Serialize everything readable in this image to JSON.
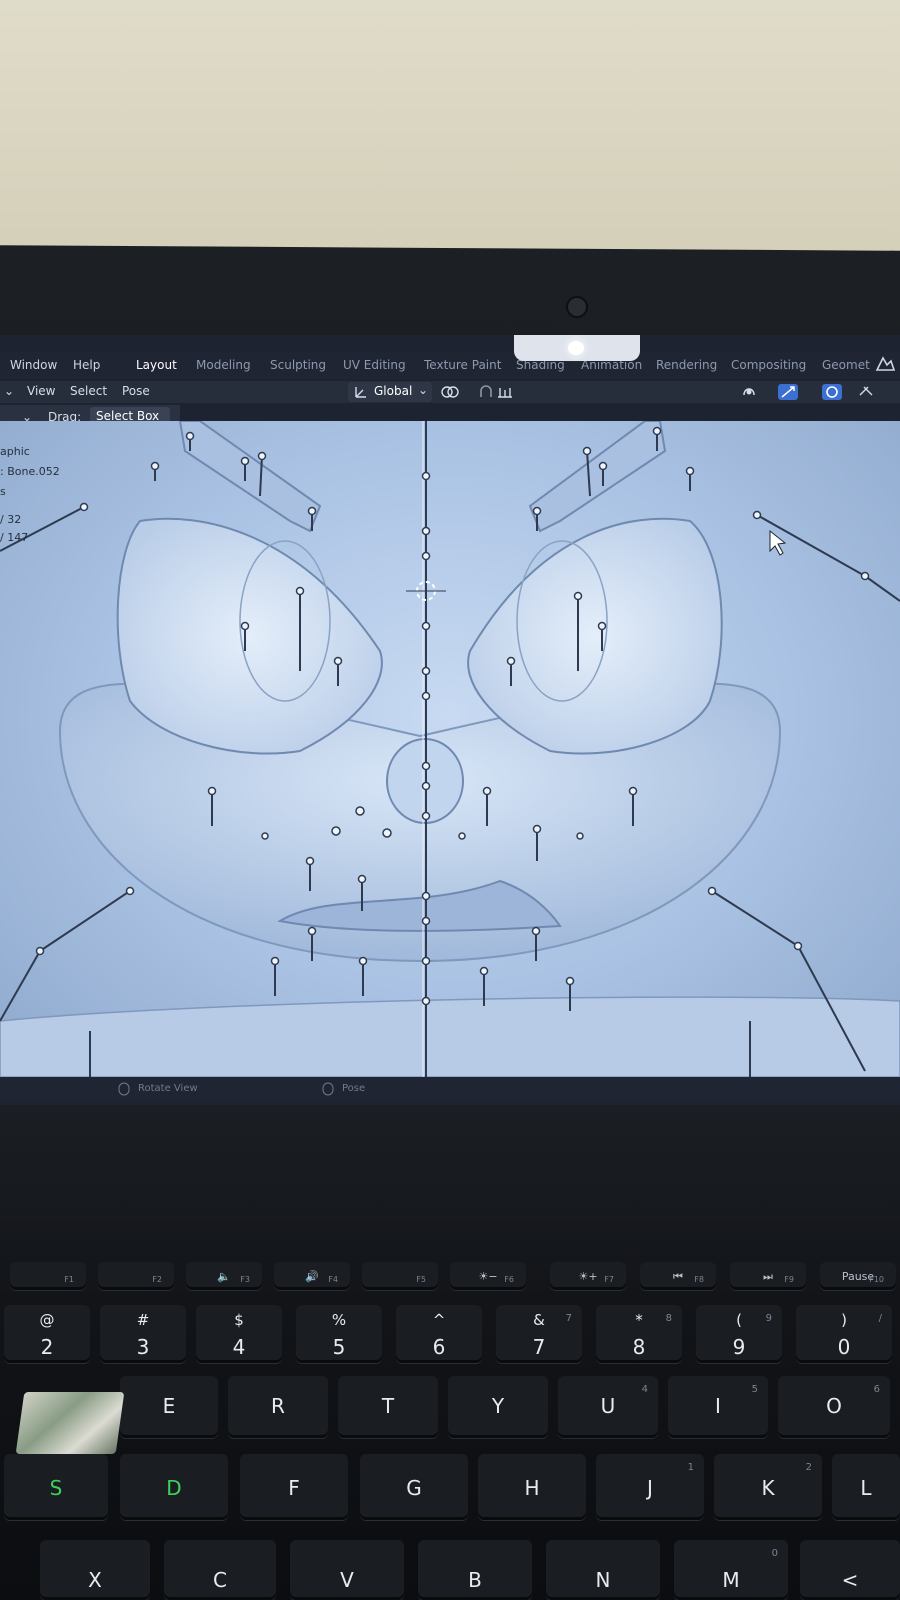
{
  "menu": {
    "items": [
      "Window",
      "Help"
    ],
    "workspace_tabs": [
      "Layout",
      "Modeling",
      "Sculpting",
      "UV Editing",
      "Texture Paint",
      "Shading",
      "Animation",
      "Rendering",
      "Compositing",
      "Geomet"
    ],
    "active_tab": "Layout"
  },
  "header": {
    "items": [
      "View",
      "Select",
      "Pose"
    ],
    "transform_orientation": "Global"
  },
  "tool_settings": {
    "drag_label": "Drag:",
    "drag_value": "Select Box"
  },
  "viewport_overlay": {
    "line1": "aphic",
    "line2": ": Bone.052",
    "line3": "s",
    "line4": "/ 32",
    "line5": "/ 147"
  },
  "statusbar": {
    "left_hint": "Rotate View",
    "mid_hint": "Pose"
  },
  "keyboard": {
    "fn_row": [
      "F1",
      "F2",
      "F3",
      "F4",
      "F5",
      "F6",
      "F7",
      "F8",
      "F9",
      "F10"
    ],
    "fn_glyphs": [
      "",
      "",
      "🔈",
      "🔊",
      "",
      "☀−",
      "☀+",
      "⏮",
      "⏭",
      "Pause"
    ],
    "number_row": [
      {
        "top": "@",
        "main": "2"
      },
      {
        "top": "#",
        "main": "3"
      },
      {
        "top": "$",
        "main": "4"
      },
      {
        "top": "%",
        "main": "5"
      },
      {
        "top": "^",
        "main": "6"
      },
      {
        "top": "&",
        "main": "7",
        "sub": "7"
      },
      {
        "top": "*",
        "main": "8",
        "sub": "8"
      },
      {
        "top": "(",
        "main": "9",
        "sub": "9"
      },
      {
        "top": ")",
        "main": "0",
        "sub": "/"
      }
    ],
    "qwerty_row": [
      {
        "main": "E"
      },
      {
        "main": "R"
      },
      {
        "main": "T"
      },
      {
        "main": "Y"
      },
      {
        "main": "U",
        "sub": "4"
      },
      {
        "main": "I",
        "sub": "5"
      },
      {
        "main": "O",
        "sub": "6"
      }
    ],
    "home_row": [
      {
        "main": "S"
      },
      {
        "main": "D"
      },
      {
        "main": "F"
      },
      {
        "main": "G"
      },
      {
        "main": "H"
      },
      {
        "main": "J",
        "sub": "1"
      },
      {
        "main": "K",
        "sub": "2"
      },
      {
        "main": "L"
      }
    ],
    "bottom_row": [
      {
        "main": "X"
      },
      {
        "main": "C"
      },
      {
        "main": "V"
      },
      {
        "main": "B"
      },
      {
        "main": "N"
      },
      {
        "main": "M",
        "sub": "0"
      },
      {
        "main": "<"
      }
    ]
  }
}
